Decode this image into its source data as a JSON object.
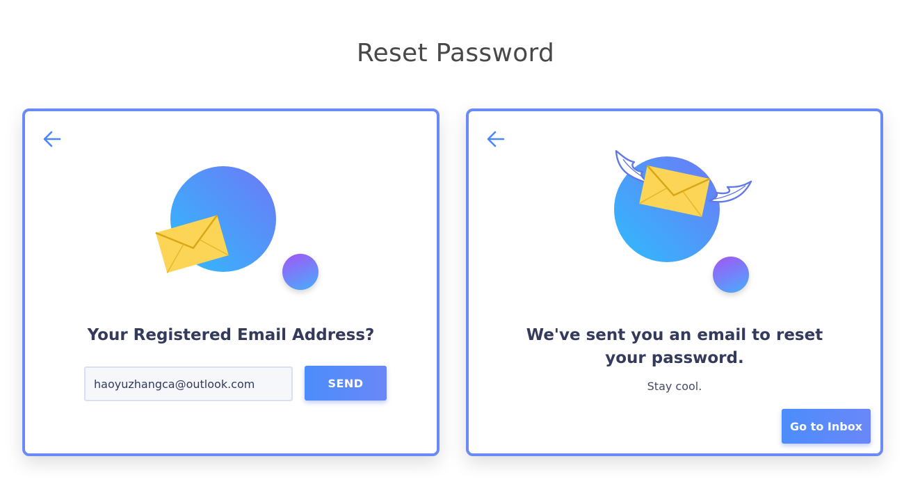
{
  "page": {
    "title": "Reset Password"
  },
  "left_card": {
    "heading": "Your Registered Email Address?",
    "email_value": "haoyuzhangca@outlook.com",
    "send_label": "SEND"
  },
  "right_card": {
    "heading_line1": "We've sent you an email to reset",
    "heading_line2": "your password.",
    "subtext": "Stay cool.",
    "inbox_label": "Go to Inbox"
  },
  "icons": {
    "back": "arrow-left-icon",
    "envelope": "envelope-icon",
    "wings": "wings-icon"
  },
  "colors": {
    "accent": "#6a8af5",
    "button_start": "#4c8dfb",
    "button_end": "#6a87f8",
    "circle_start": "#3bb6fd",
    "circle_end": "#6b7cf6",
    "small_circle_top": "#9b5ff6",
    "small_circle_bottom": "#4fa4fb",
    "envelope": "#fdd556",
    "heading_text": "#333a5c",
    "title_text": "#484848"
  }
}
